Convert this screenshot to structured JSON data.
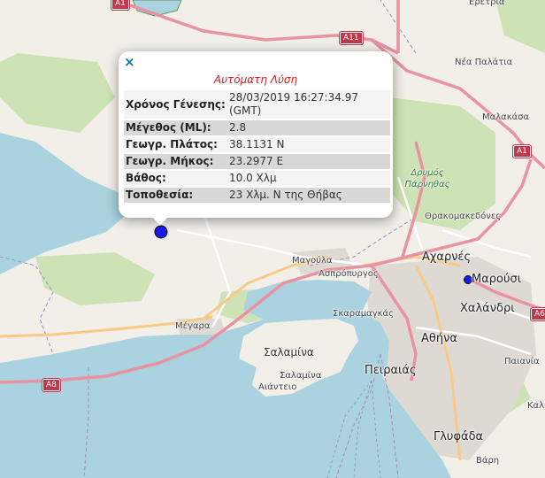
{
  "popup": {
    "close_icon": "×",
    "title": "Αυτόματη Λύση",
    "rows": [
      {
        "label": "Χρόνος Γένεσης:",
        "value": "28/03/2019 16:27:34.97 (GMT)"
      },
      {
        "label": "Μέγεθος (ML):",
        "value": "2.8"
      },
      {
        "label": "Γεωγρ. Πλάτος:",
        "value": "38.1131 N"
      },
      {
        "label": "Γεωγρ. Μήκος:",
        "value": "23.2977 E"
      },
      {
        "label": "Βάθος:",
        "value": "10.0 Χλμ"
      },
      {
        "label": "Τοποθεσία:",
        "value": "23 Χλμ. N της Θήβας"
      }
    ]
  },
  "map": {
    "colors": {
      "sea": "#aad3df",
      "land": "#f2efe9",
      "forest": "#c8dfb0",
      "urban": "#e0dcd6",
      "motorway": "#e892a2",
      "marker": "#1a1aee"
    },
    "places": {
      "eretria": "Ερέτρια",
      "nea_palatia": "Νέα Παλάτια",
      "malakasa": "Μαλακάσα",
      "drymos_parnithas": "Δρυμός Πάρνηθας",
      "thrakomakedones": "Θρακομακεδόνες",
      "acharnes": "Αχαρνές",
      "marousi": "Μαρούσι",
      "chalandri": "Χαλάνδρι",
      "magoula": "Μαγούλα",
      "aspropyrgos": "Ασπρόπυργος",
      "skaramangas": "Σκαραμαγκάς",
      "athina": "Αθήνα",
      "megara": "Μέγαρα",
      "salamina_island": "Σαλαμίνα",
      "salamina_town": "Σαλαμίνα",
      "aianteio": "Αιάντειο",
      "peiraias": "Πειραιάς",
      "paiania": "Παιανία",
      "glyfada": "Γλυφάδα",
      "vari": "Βάρη",
      "kalyvia": "Καλύβια"
    },
    "roads": {
      "a1_top": "A1",
      "a11": "A11",
      "a1": "A1",
      "a8": "A8",
      "a6": "A6"
    }
  }
}
